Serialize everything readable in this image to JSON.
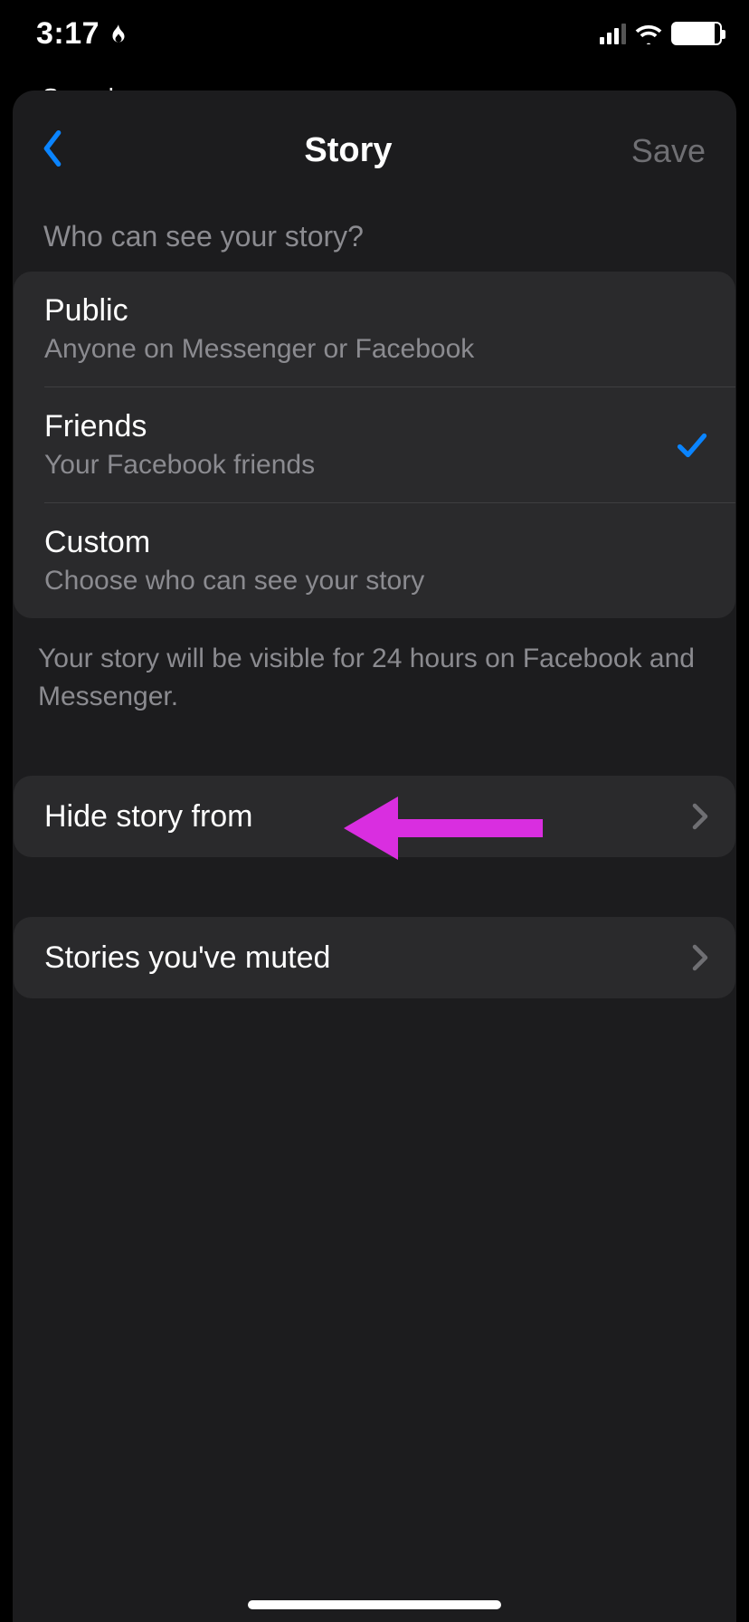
{
  "status": {
    "time": "3:17",
    "breadcrumb_label": "Search"
  },
  "nav": {
    "title": "Story",
    "save_label": "Save"
  },
  "section_header": "Who can see your story?",
  "options": [
    {
      "title": "Public",
      "subtitle": "Anyone on Messenger or Facebook",
      "selected": false
    },
    {
      "title": "Friends",
      "subtitle": "Your Facebook friends",
      "selected": true
    },
    {
      "title": "Custom",
      "subtitle": "Choose who can see your story",
      "selected": false
    }
  ],
  "footer_note": "Your story will be visible for 24 hours on Facebook and Messenger.",
  "rows": {
    "hide_label": "Hide story from",
    "muted_label": "Stories you've muted"
  },
  "colors": {
    "accent_blue": "#0a84ff",
    "annotation": "#d92ee0"
  }
}
